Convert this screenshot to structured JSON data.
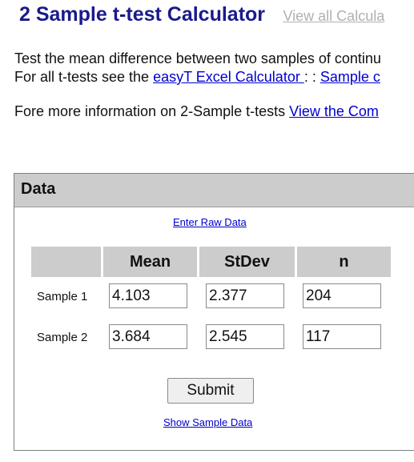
{
  "header": {
    "title": "2 Sample t-test Calculator",
    "view_all_label": "View all Calcula"
  },
  "intro": {
    "line1": "Test the mean difference between two samples of continu",
    "line2_prefix": "For all t-tests see the ",
    "easyt_link": "easyT Excel Calculator ",
    "line2_sep": ": : ",
    "sample_link": "Sample c"
  },
  "more_info": {
    "prefix": "Fore more information on 2-Sample t-tests ",
    "link": "View the Com"
  },
  "panel": {
    "title": "Data",
    "raw_data_link": "Enter Raw Data",
    "columns": [
      "",
      "Mean",
      "StDev",
      "n"
    ],
    "rows": [
      {
        "label": "Sample 1",
        "mean": "4.103",
        "stdev": "2.377",
        "n": "204"
      },
      {
        "label": "Sample 2",
        "mean": "3.684",
        "stdev": "2.545",
        "n": "117"
      }
    ],
    "submit_label": "Submit",
    "sample_data_link": "Show Sample Data"
  }
}
